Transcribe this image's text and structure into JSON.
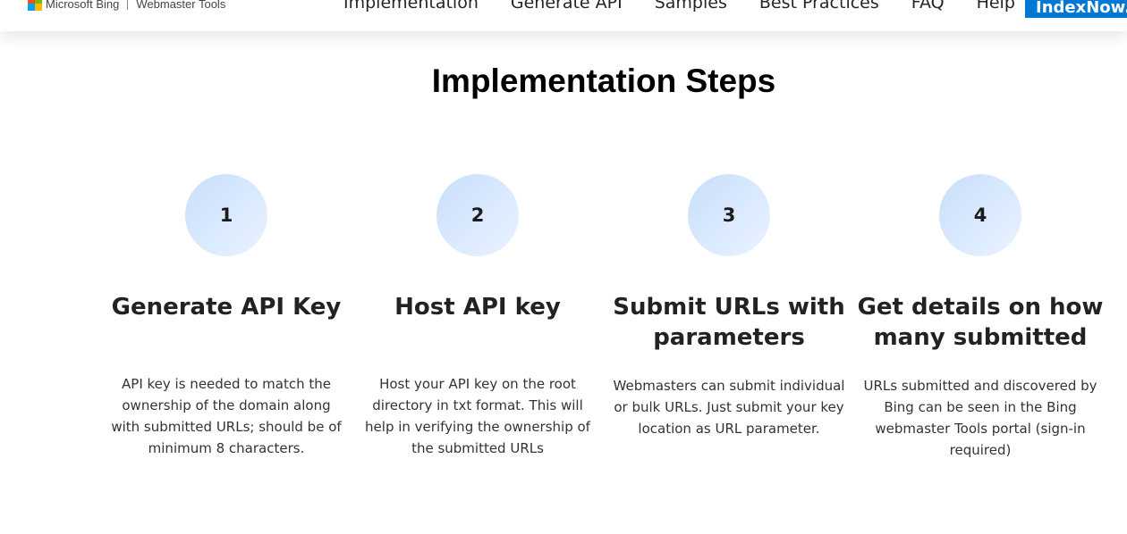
{
  "header": {
    "brand_name": "Microsoft Bing",
    "brand_product": "Webmaster Tools",
    "logo_colors": [
      "#f25022",
      "#7fba00",
      "#00a4ef",
      "#ffb900"
    ],
    "nav": [
      {
        "label": "Implementation"
      },
      {
        "label": "Generate API"
      },
      {
        "label": "Samples"
      },
      {
        "label": "Best Practices"
      },
      {
        "label": "FAQ"
      },
      {
        "label": "Help"
      }
    ],
    "cta_label": "IndexNow.o",
    "cta_color": "#0078d4"
  },
  "section": {
    "title": "Implementation Steps",
    "steps": [
      {
        "number": "1",
        "title": "Generate API Key",
        "desc": "API key is needed to match the ownership of the domain along with submitted URLs; should be of minimum 8 characters."
      },
      {
        "number": "2",
        "title": "Host API key",
        "desc": "Host your API key on the root directory in txt format. This will help in verifying the ownership of the submitted URLs"
      },
      {
        "number": "3",
        "title": "Submit URLs with parameters",
        "desc": "Webmasters can submit individual or bulk URLs. Just submit your key location as URL parameter."
      },
      {
        "number": "4",
        "title": "Get details on how many submitted",
        "desc": "URLs submitted and discovered by Bing can be seen in the Bing webmaster Tools portal (sign-in required)"
      }
    ]
  }
}
